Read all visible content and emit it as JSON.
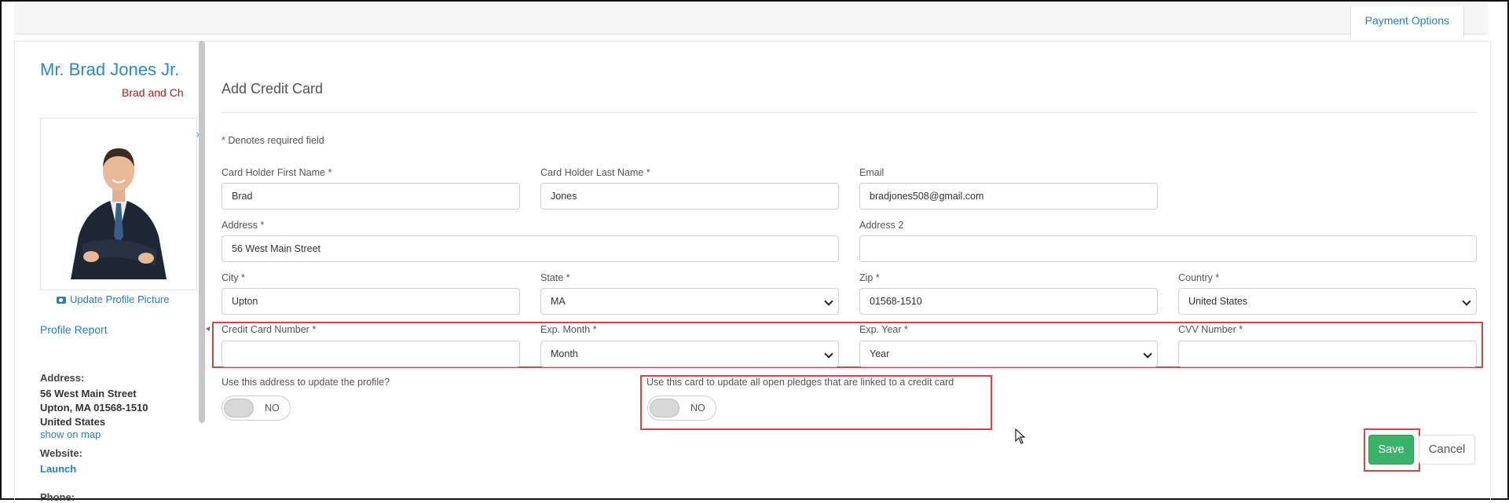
{
  "header": {
    "tab_payment_options": "Payment Options"
  },
  "profile": {
    "name": "Mr. Brad Jones Jr.",
    "org": "Brad and Ch",
    "update_picture": "Update Profile Picture",
    "profile_report": "Profile Report",
    "address_label": "Address:",
    "address_lines": [
      "56 West Main Street",
      "Upton, MA 01568-1510",
      "United States"
    ],
    "show_on_map": "show on map",
    "website_label": "Website:",
    "website_link": "Launch",
    "phone_label": "Phone:"
  },
  "form": {
    "title": "Add Credit Card",
    "required_note_star": "*",
    "required_note": "Denotes required field",
    "fields": {
      "first_name": {
        "label": "Card Holder First Name *",
        "value": "Brad"
      },
      "last_name": {
        "label": "Card Holder Last Name *",
        "value": "Jones"
      },
      "email": {
        "label": "Email",
        "value": "bradjones508@gmail.com"
      },
      "address": {
        "label": "Address *",
        "value": "56 West Main Street"
      },
      "address2": {
        "label": "Address 2",
        "value": ""
      },
      "city": {
        "label": "City *",
        "value": "Upton"
      },
      "state": {
        "label": "State *",
        "value": "MA"
      },
      "zip": {
        "label": "Zip *",
        "value": "01568-1510"
      },
      "country": {
        "label": "Country *",
        "value": "United States"
      },
      "card_number": {
        "label": "Credit Card Number *",
        "value": ""
      },
      "exp_month": {
        "label": "Exp. Month *",
        "value": "Month"
      },
      "exp_year": {
        "label": "Exp. Year *",
        "value": "Year"
      },
      "cvv": {
        "label": "CVV Number *",
        "value": ""
      }
    },
    "toggle_update_profile": {
      "label": "Use this address to update the profile?",
      "state": "NO"
    },
    "toggle_update_pledges": {
      "label": "Use this card to update all open pledges that are linked to a credit card",
      "state": "NO"
    },
    "save_label": "Save",
    "cancel_label": "Cancel"
  },
  "colors": {
    "accent": "#2a8bc9",
    "save": "#3bb26a",
    "highlight": "#d64545",
    "org": "#b01d1d"
  },
  "icons": {
    "camera": "camera-icon",
    "collapse": "chevron-right-icon",
    "cursor": "mouse-pointer-icon"
  }
}
